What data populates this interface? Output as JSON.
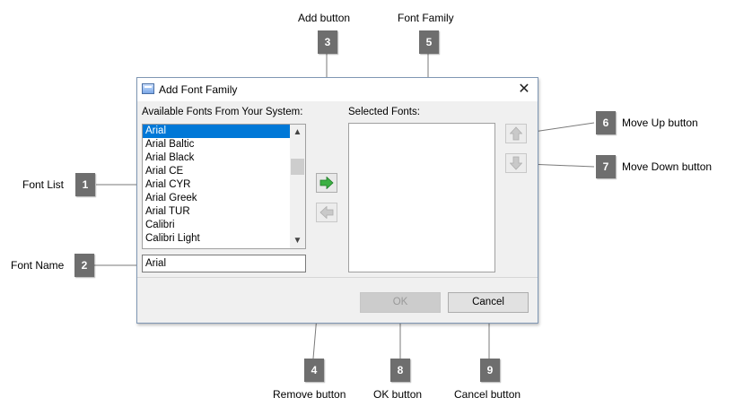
{
  "dialog": {
    "title": "Add Font Family",
    "close_glyph": "✕",
    "available_label": "Available Fonts From Your System:",
    "selected_label": "Selected Fonts:",
    "font_list": [
      "Arial",
      "Arial Baltic",
      "Arial Black",
      "Arial CE",
      "Arial CYR",
      "Arial Greek",
      "Arial TUR",
      "Calibri",
      "Calibri Light"
    ],
    "selected_font": "Arial",
    "font_name_value": "Arial",
    "selected_fonts": [],
    "ok_label": "OK",
    "cancel_label": "Cancel",
    "scroll_up_glyph": "▲",
    "scroll_down_glyph": "▼"
  },
  "callouts": [
    {
      "number": "1",
      "text": "Font List"
    },
    {
      "number": "2",
      "text": "Font Name"
    },
    {
      "number": "3",
      "text": "Add  button"
    },
    {
      "number": "4",
      "text": "Remove  button"
    },
    {
      "number": "5",
      "text": "Font Family"
    },
    {
      "number": "6",
      "text": "Move Up  button"
    },
    {
      "number": "7",
      "text": "Move Down  button"
    },
    {
      "number": "8",
      "text": "OK button"
    },
    {
      "number": "9",
      "text": "Cancel button"
    }
  ],
  "colors": {
    "add_arrow": "#3cb043",
    "disabled_arrow": "#b8b8b8",
    "selection": "#0078d7",
    "badge": "#6e6e6e"
  }
}
